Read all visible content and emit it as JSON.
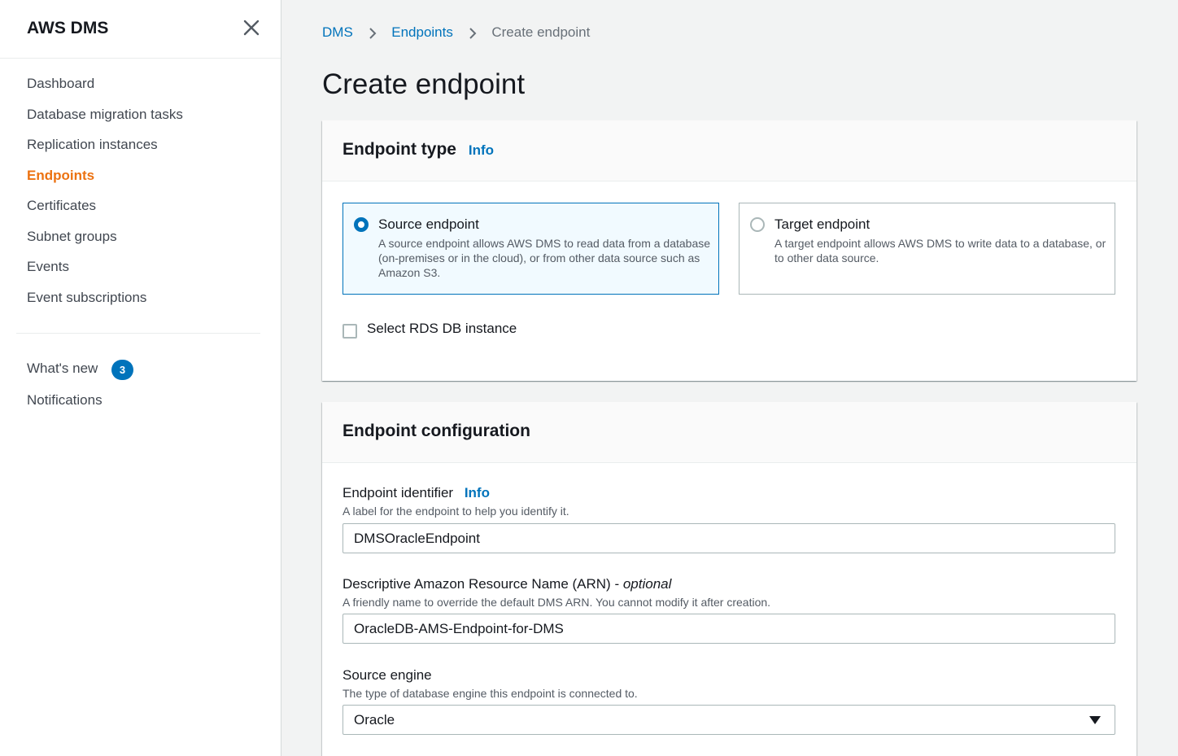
{
  "sidebar": {
    "title": "AWS DMS",
    "items": [
      {
        "label": "Dashboard"
      },
      {
        "label": "Database migration tasks"
      },
      {
        "label": "Replication instances"
      },
      {
        "label": "Endpoints"
      },
      {
        "label": "Certificates"
      },
      {
        "label": "Subnet groups"
      },
      {
        "label": "Events"
      },
      {
        "label": "Event subscriptions"
      }
    ],
    "whats_new": {
      "label": "What's new",
      "badge": "3"
    },
    "notifications": {
      "label": "Notifications"
    }
  },
  "breadcrumb": {
    "items": [
      "DMS",
      "Endpoints"
    ],
    "current": "Create endpoint"
  },
  "page_title": "Create endpoint",
  "endpoint_type": {
    "title": "Endpoint type",
    "info": "Info",
    "source": {
      "title": "Source endpoint",
      "description": "A source endpoint allows AWS DMS to read data from a database (on-premises or in the cloud), or from other data source such as Amazon S3.",
      "selected": true
    },
    "target": {
      "title": "Target endpoint",
      "description": "A target endpoint allows AWS DMS to write data to a database, or to other data source.",
      "selected": false
    },
    "rds_checkbox": {
      "label": "Select RDS DB instance",
      "checked": false
    }
  },
  "endpoint_config": {
    "title": "Endpoint configuration",
    "identifier": {
      "label": "Endpoint identifier",
      "info": "Info",
      "description": "A label for the endpoint to help you identify it.",
      "value": "DMSOracleEndpoint"
    },
    "arn": {
      "label": "Descriptive Amazon Resource Name (ARN) - ",
      "optional": "optional",
      "description": "A friendly name to override the default DMS ARN. You cannot modify it after creation.",
      "value": "OracleDB-AMS-Endpoint-for-DMS"
    },
    "engine": {
      "label": "Source engine",
      "description": "The type of database engine this endpoint is connected to.",
      "value": "Oracle"
    }
  },
  "colors": {
    "accent": "#0073bb",
    "active_nav": "#ec7211"
  }
}
